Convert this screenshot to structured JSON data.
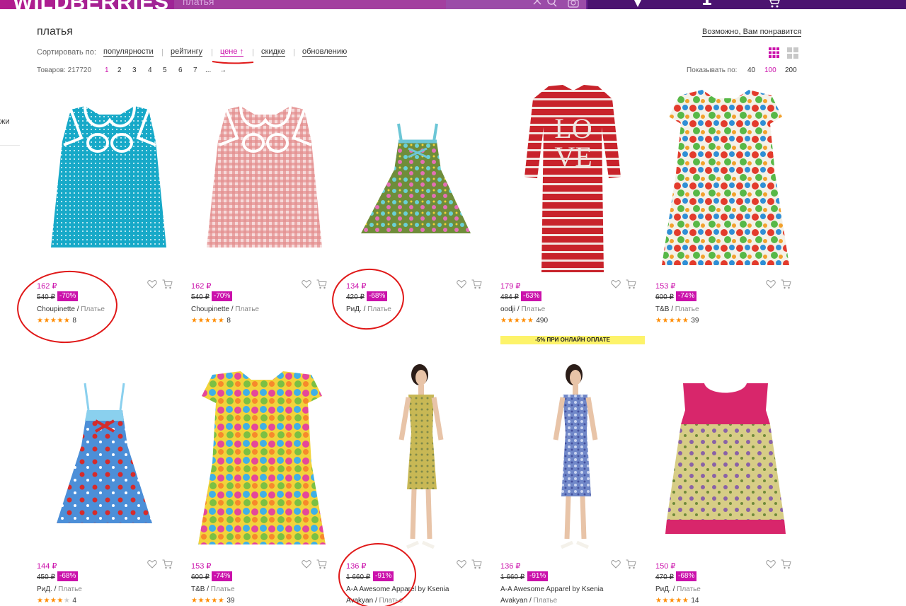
{
  "header": {
    "logo": "WILDBERRIES",
    "search_value": "платья"
  },
  "page": {
    "title": "платья",
    "maybe_like": "Возможно, Вам понравится",
    "left_cut_text": "жи"
  },
  "sort": {
    "label": "Сортировать по:",
    "options": [
      "популярности",
      "рейтингу",
      "цене ↑",
      "скидке",
      "обновлению"
    ],
    "active": "цене ↑"
  },
  "listing": {
    "count_label": "Товаров: 217720",
    "pages": [
      "1",
      "2",
      "3",
      "4",
      "5",
      "6",
      "7",
      "...",
      "→"
    ],
    "current_page": "1",
    "show_label": "Показывать по:",
    "show_options": [
      "40",
      "100",
      "200"
    ],
    "show_active": "100"
  },
  "colors": {
    "accent": "#cb11ab",
    "star": "#ff8c00",
    "promo_bg": "#fdf36a",
    "annotation_red": "#e01818"
  },
  "products": [
    {
      "price": "162 ₽",
      "old_price": "540 ₽",
      "discount": "-70%",
      "brand": "Choupinette",
      "category": "Платье",
      "rating": 5,
      "reviews": "8"
    },
    {
      "price": "162 ₽",
      "old_price": "540 ₽",
      "discount": "-70%",
      "brand": "Choupinette",
      "category": "Платье",
      "rating": 5,
      "reviews": "8"
    },
    {
      "price": "134 ₽",
      "old_price": "420 ₽",
      "discount": "-68%",
      "brand": "РиД.",
      "category": "Платье",
      "rating": 0,
      "reviews": ""
    },
    {
      "price": "179 ₽",
      "old_price": "484 ₽",
      "discount": "-63%",
      "brand": "oodji",
      "category": "Платье",
      "rating": 5,
      "reviews": "490",
      "promo": "-5% ПРИ ОНЛАЙН ОПЛАТЕ"
    },
    {
      "price": "153 ₽",
      "old_price": "600 ₽",
      "discount": "-74%",
      "brand": "T&B",
      "category": "Платье",
      "rating": 5,
      "reviews": "39"
    },
    {
      "price": "144 ₽",
      "old_price": "450 ₽",
      "discount": "-68%",
      "brand": "РиД.",
      "category": "Платье",
      "rating": 4,
      "reviews": "4"
    },
    {
      "price": "153 ₽",
      "old_price": "600 ₽",
      "discount": "-74%",
      "brand": "T&B",
      "category": "Платье",
      "rating": 5,
      "reviews": "39"
    },
    {
      "price": "136 ₽",
      "old_price": "1 660 ₽",
      "discount": "-91%",
      "brand": "A-A Awesome Apparel by Ksenia",
      "brand2": "Avakyan",
      "category": "Платье",
      "rating": 0,
      "reviews": ""
    },
    {
      "price": "136 ₽",
      "old_price": "1 660 ₽",
      "discount": "-91%",
      "brand": "A-A Awesome Apparel by Ksenia",
      "brand2": "Avakyan",
      "category": "Платье",
      "rating": 0,
      "reviews": ""
    },
    {
      "price": "150 ₽",
      "old_price": "470 ₽",
      "discount": "-68%",
      "brand": "РиД.",
      "category": "Платье",
      "rating": 5,
      "reviews": "14"
    }
  ]
}
